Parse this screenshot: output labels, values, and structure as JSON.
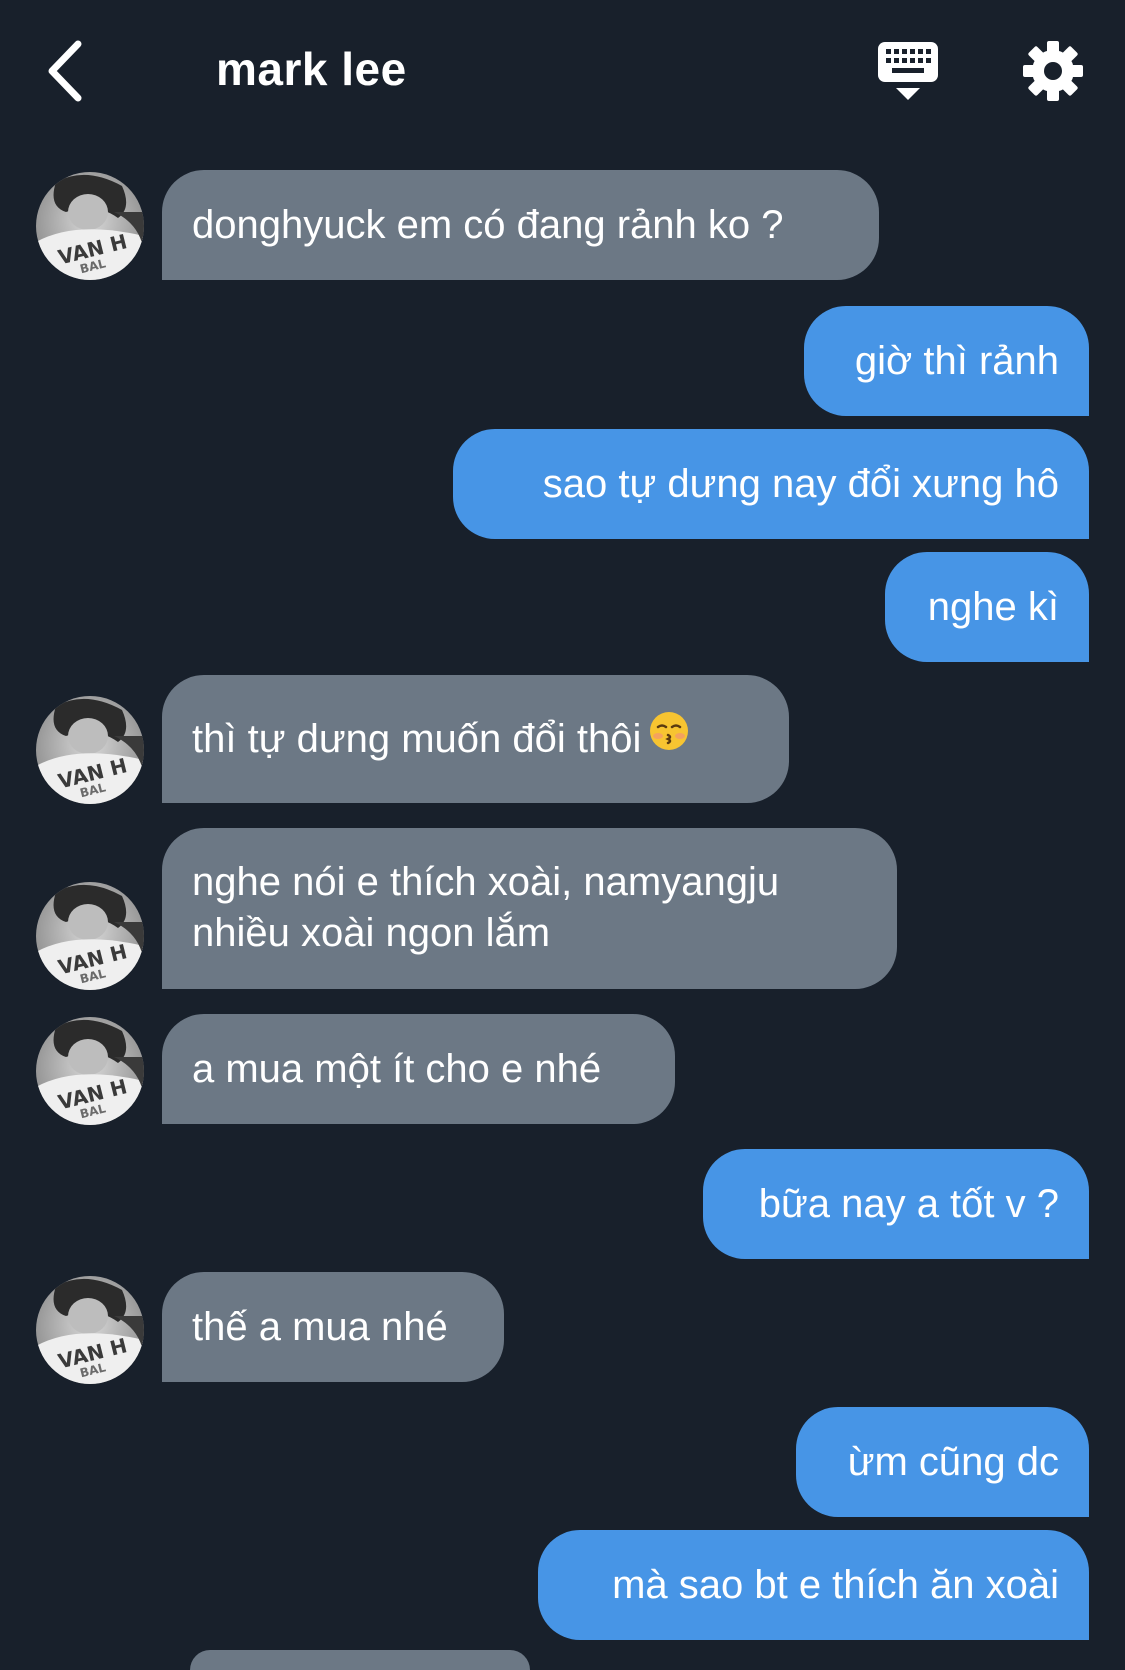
{
  "header": {
    "title": "mark lee",
    "back_icon": "chevron-left-icon",
    "keyboard_icon": "keyboard-icon",
    "settings_icon": "gear-icon"
  },
  "colors": {
    "background": "#18202b",
    "received_bubble": "#6c7885",
    "sent_bubble": "#4795e6",
    "text": "#ffffff"
  },
  "messages": [
    {
      "sender": "contact",
      "text": "donghyuck em có đang rảnh ko ?"
    },
    {
      "sender": "me",
      "text": "giờ thì rảnh"
    },
    {
      "sender": "me",
      "text": "sao tự dưng nay đổi xưng hô"
    },
    {
      "sender": "me",
      "text": "nghe kì"
    },
    {
      "sender": "contact",
      "text": "thì tự dưng muốn đổi thôi",
      "emoji": "kissing-face-closed-eyes"
    },
    {
      "sender": "contact",
      "lines": [
        "nghe nói e thích xoài, namyangju",
        "nhiều xoài ngon lắm"
      ]
    },
    {
      "sender": "contact",
      "text": "a mua một ít cho e nhé"
    },
    {
      "sender": "me",
      "text": "bữa nay a tốt v ?"
    },
    {
      "sender": "contact",
      "text": "thế a mua nhé"
    },
    {
      "sender": "me",
      "text": "ừm cũng dc"
    },
    {
      "sender": "me",
      "text": "mà sao bt e thích ăn xoài"
    }
  ]
}
